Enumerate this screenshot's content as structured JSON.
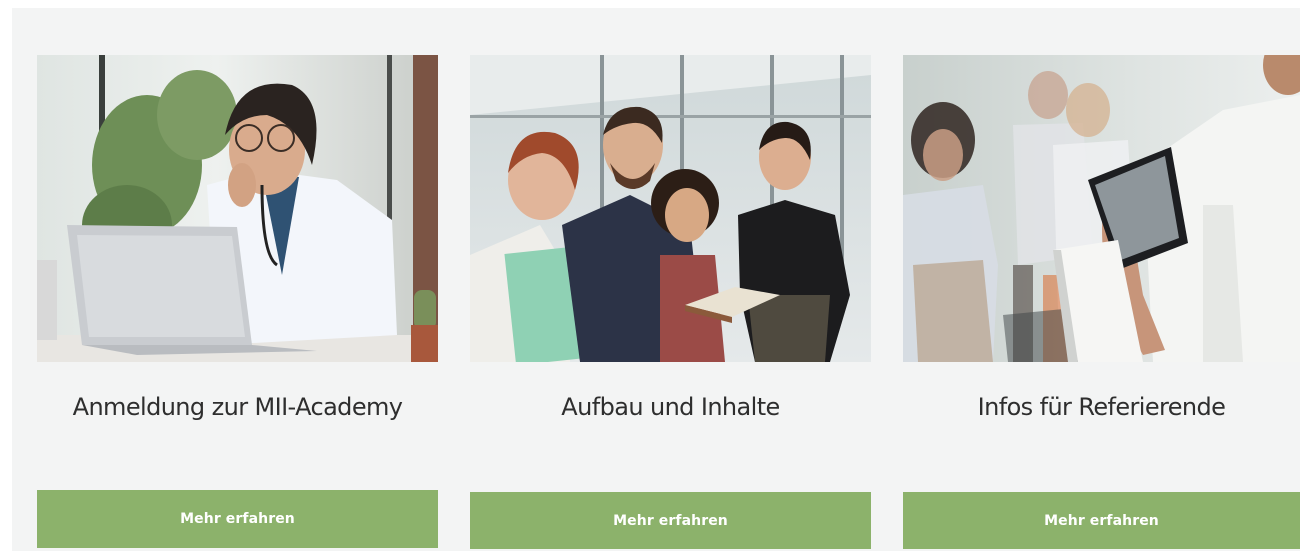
{
  "cards": [
    {
      "title": "Anmeldung zur MII-Academy",
      "button_label": "Mehr erfahren",
      "image": "doctor-at-laptop-photo"
    },
    {
      "title": "Aufbau und Inhalte",
      "button_label": "Mehr erfahren",
      "image": "group-of-colleagues-photo"
    },
    {
      "title": "Infos für Referierende",
      "button_label": "Mehr erfahren",
      "image": "speaker-with-tablet-photo"
    }
  ],
  "colors": {
    "section_background": "#f3f4f4",
    "button_background": "#8cb26b",
    "button_text": "#ffffff",
    "title_text": "#2e2e2e"
  }
}
